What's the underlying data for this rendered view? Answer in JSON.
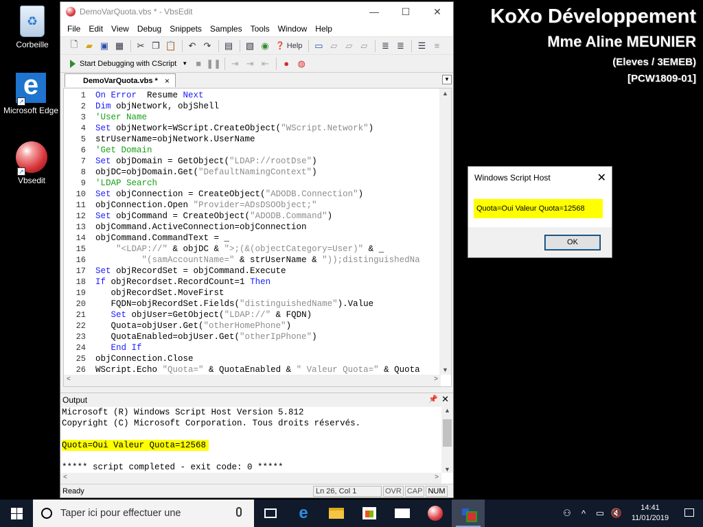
{
  "desktop": {
    "icons": [
      {
        "label": "Corbeille"
      },
      {
        "label": "Microsoft Edge"
      },
      {
        "label": "Vbsedit"
      }
    ],
    "branding": {
      "line1": "KoXo Développement",
      "line2": "Mme Aline MEUNIER",
      "line3": "(Eleves / 3EMEB)",
      "line4": "[PCW1809-01]"
    }
  },
  "window": {
    "title": "DemoVarQuota.vbs * - VbsEdit",
    "controls": {
      "minimize": "—",
      "maximize": "☐",
      "close": "✕"
    },
    "menu": [
      "File",
      "Edit",
      "View",
      "Debug",
      "Snippets",
      "Samples",
      "Tools",
      "Window",
      "Help"
    ],
    "toolbar": {
      "help_label": "Help"
    },
    "debug_toolbar": {
      "start_label": "Start Debugging with CScript"
    },
    "tab": {
      "label": "DemoVarQuota.vbs *",
      "close": "×"
    },
    "editor": {
      "lines": [
        [
          [
            "kw",
            "On Error"
          ],
          [
            "",
            "  Resume "
          ],
          [
            "kw",
            "Next"
          ]
        ],
        [
          [
            "kw",
            "Dim"
          ],
          [
            "",
            " objNetwork, objShell"
          ]
        ],
        [
          [
            "cm",
            "'User Name"
          ]
        ],
        [
          [
            "kw",
            "Set"
          ],
          [
            "",
            " objNetwork=WScript.CreateObject("
          ],
          [
            "st",
            "\"WScript.Network\""
          ],
          [
            "",
            ")"
          ]
        ],
        [
          [
            "",
            "strUserName=objNetwork.UserName"
          ]
        ],
        [
          [
            "cm",
            "'Get Domain"
          ]
        ],
        [
          [
            "kw",
            "Set"
          ],
          [
            "",
            " objDomain = GetObject("
          ],
          [
            "st",
            "\"LDAP://rootDse\""
          ],
          [
            "",
            ")"
          ]
        ],
        [
          [
            "",
            "objDC=objDomain.Get("
          ],
          [
            "st",
            "\"DefaultNamingContext\""
          ],
          [
            "",
            ")"
          ]
        ],
        [
          [
            "cm",
            "'LDAP Search"
          ]
        ],
        [
          [
            "kw",
            "Set"
          ],
          [
            "",
            " objConnection = CreateObject("
          ],
          [
            "st",
            "\"ADODB.Connection\""
          ],
          [
            "",
            ")"
          ]
        ],
        [
          [
            "",
            "objConnection.Open "
          ],
          [
            "st",
            "\"Provider=ADsDSOObject;\""
          ]
        ],
        [
          [
            "kw",
            "Set"
          ],
          [
            "",
            " objCommand = CreateObject("
          ],
          [
            "st",
            "\"ADODB.Command\""
          ],
          [
            "",
            ")"
          ]
        ],
        [
          [
            "",
            "objCommand.ActiveConnection=objConnection"
          ]
        ],
        [
          [
            "",
            "objCommand.CommandText = _"
          ]
        ],
        [
          [
            "",
            "    "
          ],
          [
            "st",
            "\"<LDAP://\""
          ],
          [
            "",
            " & objDC & "
          ],
          [
            "st",
            "\">;(&(objectCategory=User)\""
          ],
          [
            "",
            " & _"
          ]
        ],
        [
          [
            "",
            "         "
          ],
          [
            "st",
            "\"(samAccountName=\""
          ],
          [
            "",
            " & strUserName & "
          ],
          [
            "st",
            "\"));distinguishedNa"
          ]
        ],
        [
          [
            "kw",
            "Set"
          ],
          [
            "",
            " objRecordSet = objCommand.Execute"
          ]
        ],
        [
          [
            "kw",
            "If"
          ],
          [
            "",
            " objRecordset.RecordCount=1 "
          ],
          [
            "kw",
            "Then"
          ]
        ],
        [
          [
            "",
            "   objRecordSet.MoveFirst"
          ]
        ],
        [
          [
            "",
            "   FQDN=objRecordSet.Fields("
          ],
          [
            "st",
            "\"distinguishedName\""
          ],
          [
            "",
            ").Value"
          ]
        ],
        [
          [
            "",
            "   "
          ],
          [
            "kw",
            "Set"
          ],
          [
            "",
            " objUser=GetObject("
          ],
          [
            "st",
            "\"LDAP://\""
          ],
          [
            "",
            " & FQDN)"
          ]
        ],
        [
          [
            "",
            "   Quota=objUser.Get("
          ],
          [
            "st",
            "\"otherHomePhone\""
          ],
          [
            "",
            ")"
          ]
        ],
        [
          [
            "",
            "   QuotaEnabled=objUser.Get("
          ],
          [
            "st",
            "\"otherIpPhone\""
          ],
          [
            "",
            ")"
          ]
        ],
        [
          [
            "",
            "   "
          ],
          [
            "kw",
            "End If"
          ]
        ],
        [
          [
            "",
            "objConnection.Close"
          ]
        ],
        [
          [
            "",
            "WScript.Echo "
          ],
          [
            "st",
            "\"Quota=\""
          ],
          [
            "",
            " & QuotaEnabled & "
          ],
          [
            "st",
            "\" Valeur Quota=\""
          ],
          [
            "",
            " & Quota"
          ]
        ]
      ]
    },
    "output": {
      "header": "Output",
      "lines": [
        "Microsoft (R) Windows Script Host Version 5.812",
        "Copyright (C) Microsoft Corporation. Tous droits réservés.",
        "",
        "Quota=Oui Valeur Quota=12568",
        "",
        "***** script completed - exit code: 0 *****"
      ],
      "highlight_line": 3,
      "highlight_color": "#ffff00"
    },
    "status": {
      "ready": "Ready",
      "position": "Ln 26, Col 1",
      "ovr": "OVR",
      "caps": "CAP",
      "num": "NUM"
    }
  },
  "dialog": {
    "title": "Windows Script Host",
    "close": "✕",
    "message": "Quota=Oui Valeur Quota=12568",
    "ok_label": "OK"
  },
  "taskbar": {
    "search_placeholder": "Taper ici pour effectuer une",
    "time": "14:41",
    "date": "11/01/2019"
  },
  "colors": {
    "keyword": "#1a1aff",
    "comment": "#16a016",
    "string": "#8c8c8c",
    "highlight": "#ffff00",
    "taskbar": "#101a2b"
  }
}
